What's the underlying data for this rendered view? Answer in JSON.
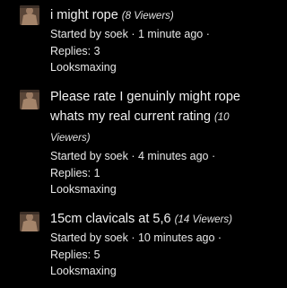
{
  "threads": [
    {
      "title": "i might rope",
      "viewers": "(8 Viewers)",
      "started": "Started by soek · 1 minute ago ·",
      "replies": "Replies: 3",
      "forum": "Looksmaxing"
    },
    {
      "title": "Please rate I genuinly might rope whats my real current rating",
      "viewers": "(10 Viewers)",
      "started": "Started by soek · 4 minutes ago ·",
      "replies": "Replies: 1",
      "forum": "Looksmaxing"
    },
    {
      "title": "15cm clavicals at 5,6",
      "viewers": "(14 Viewers)",
      "started": "Started by soek · 10 minutes ago ·",
      "replies": "Replies: 5",
      "forum": "Looksmaxing"
    }
  ],
  "colors": {
    "background": "#000000",
    "text": "#f2f2f2",
    "avatar": "#6f5a48"
  },
  "icons": [
    "avatar-image"
  ]
}
